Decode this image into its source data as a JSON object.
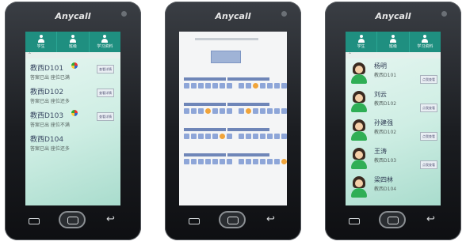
{
  "brand": "Anycall",
  "screen1": {
    "tabs": [
      {
        "label": "学生"
      },
      {
        "label": "班级"
      },
      {
        "label": "学习资料"
      }
    ],
    "list": [
      {
        "room": "教西D101",
        "sub": "答案已出  座位已满",
        "button": "查看详情"
      },
      {
        "room": "教西D102",
        "sub": "答案已出  座位还多",
        "button": "查看详情"
      },
      {
        "room": "教西D103",
        "sub": "答案已出  座位不满",
        "button": "查看详情"
      },
      {
        "room": "教西D104",
        "sub": "答案已出  座位还多",
        "button": ""
      }
    ]
  },
  "screen2": {
    "rows": [
      {
        "left": [
          0,
          0,
          0,
          0,
          0,
          0,
          0
        ],
        "right": [
          0,
          0,
          1,
          0,
          0,
          0,
          0
        ]
      },
      {
        "left": [
          0,
          0,
          0,
          1,
          0,
          0,
          0
        ],
        "right": [
          0,
          1,
          0,
          0,
          0,
          0,
          0
        ]
      },
      {
        "left": [
          0,
          0,
          0,
          0,
          0,
          1,
          0
        ],
        "right": [
          0,
          0,
          0,
          0,
          0,
          0,
          0
        ]
      },
      {
        "left": [
          0,
          0,
          0,
          0,
          0,
          0,
          0
        ],
        "right": [
          0,
          0,
          0,
          0,
          0,
          0,
          1
        ]
      }
    ]
  },
  "screen3": {
    "tabs": [
      {
        "label": "学生"
      },
      {
        "label": "班级"
      },
      {
        "label": "学习资料"
      }
    ],
    "students": [
      {
        "name": "杨明",
        "room": "教西D101",
        "button": "点我查看"
      },
      {
        "name": "刘云",
        "room": "教西D102",
        "button": "点我查看"
      },
      {
        "name": "孙建强",
        "room": "教西D102",
        "button": "点我查看"
      },
      {
        "name": "王涛",
        "room": "教西D103",
        "button": "点我查看"
      },
      {
        "name": "梁四林",
        "room": "教西D104",
        "button": ""
      }
    ]
  },
  "colors": {
    "accent": "#1f8f80",
    "seat_empty": "#8ea6d8",
    "seat_taken": "#f0a43a"
  }
}
